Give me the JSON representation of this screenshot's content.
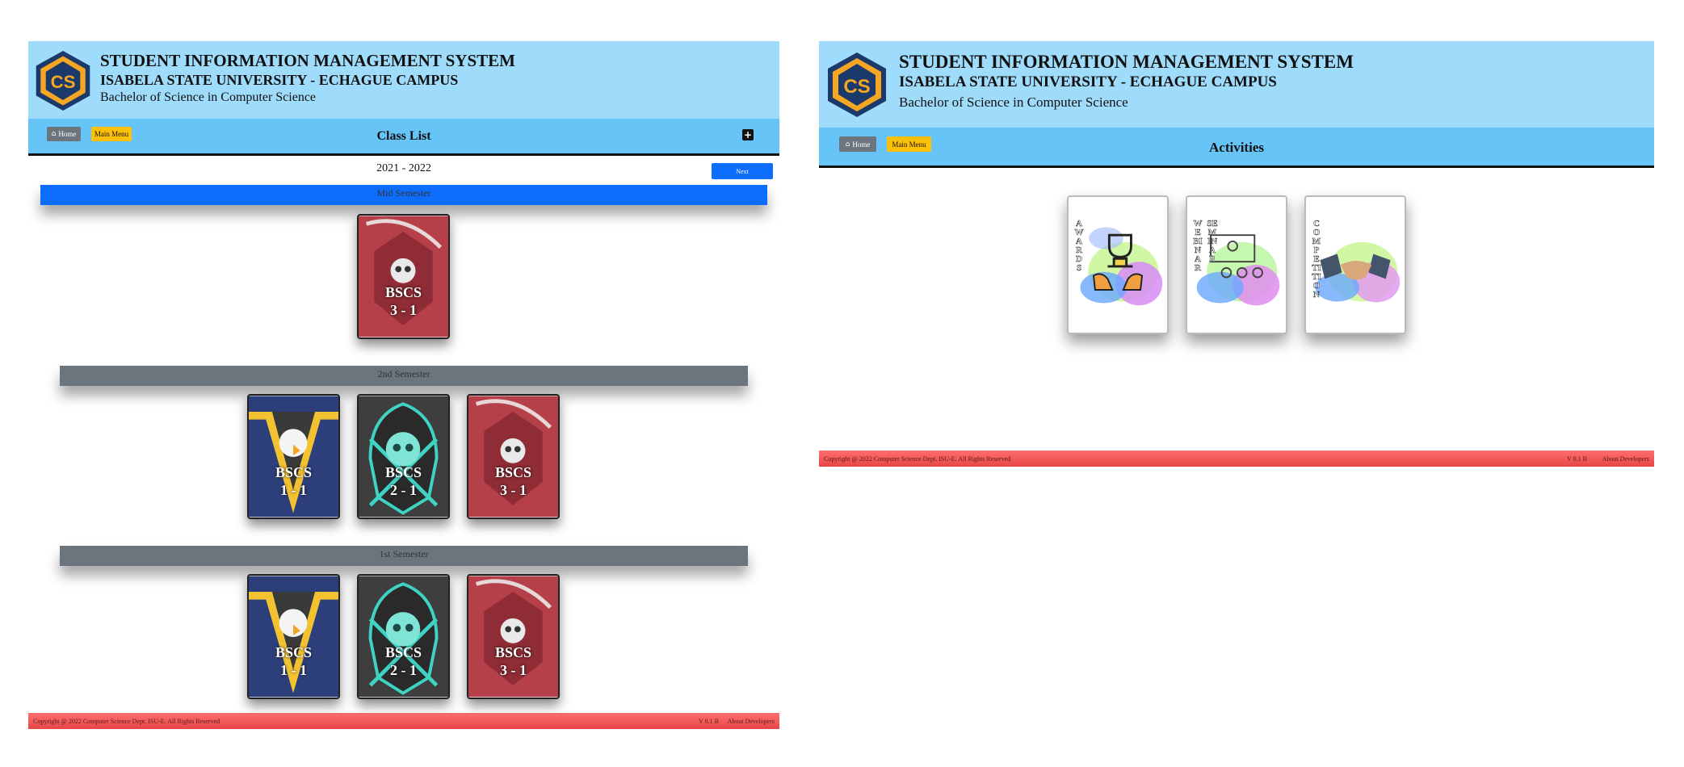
{
  "header": {
    "title": "STUDENT INFORMATION MANAGEMENT SYSTEM",
    "university": "ISABELA STATE UNIVERSITY - ECHAGUE CAMPUS",
    "program": "Bachelor of Science in Computer Science",
    "logo_text": "CS"
  },
  "nav": {
    "home_label": "Home",
    "main_menu_label": "Main Menu",
    "add_icon": "plus-square-icon"
  },
  "class_list_page": {
    "page_title": "Class List",
    "school_year": "2021 - 2022",
    "next_label": "Next",
    "semesters": [
      {
        "label": "Mid Semester",
        "classes": [
          {
            "line1": "BSCS",
            "line2": "3 - 1",
            "theme": "reaper-red"
          }
        ]
      },
      {
        "label": "2nd Semester",
        "classes": [
          {
            "line1": "BSCS",
            "line2": "1 - 1",
            "theme": "eagle-yellow"
          },
          {
            "line1": "BSCS",
            "line2": "2 - 1",
            "theme": "skull-teal"
          },
          {
            "line1": "BSCS",
            "line2": "3 - 1",
            "theme": "reaper-red"
          }
        ]
      },
      {
        "label": "1st Semester",
        "classes": [
          {
            "line1": "BSCS",
            "line2": "1 - 1",
            "theme": "eagle-yellow"
          },
          {
            "line1": "BSCS",
            "line2": "2 - 1",
            "theme": "skull-teal"
          },
          {
            "line1": "BSCS",
            "line2": "3 - 1",
            "theme": "reaper-red"
          }
        ]
      }
    ]
  },
  "activities_page": {
    "page_title": "Activities",
    "cards": [
      {
        "label": "AWARDS",
        "icon": "trophy-icon"
      },
      {
        "label": "WEBINAR",
        "label2": "SEMINAR",
        "icon": "presentation-icon"
      },
      {
        "label": "COMPETITION",
        "icon": "handshake-icon"
      }
    ]
  },
  "footer": {
    "copyright": "Copyright @ 2022 Computer Science Dept. ISU-E. All Rights Reserved",
    "version": "V 0.1 B",
    "developers_link": "About Developers"
  },
  "colors": {
    "header_bg": "#9fdcfb",
    "nav_bg": "#66c4f7",
    "primary": "#0d6efd",
    "secondary": "#6c757d",
    "warning": "#ffc107",
    "footer": "#ef5350"
  }
}
